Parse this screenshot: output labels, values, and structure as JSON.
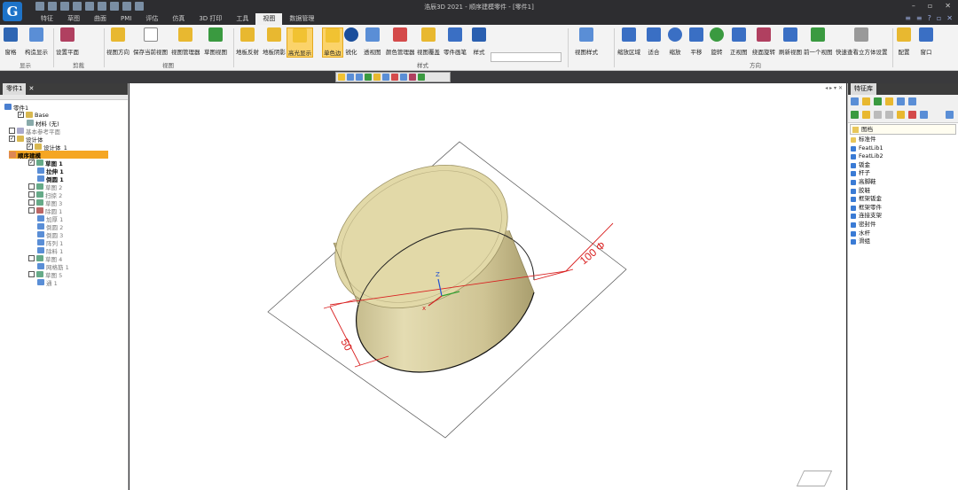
{
  "app": {
    "title": "浩辰3D 2021 - 顺序建模零件 - [零件1]"
  },
  "tabs": [
    "特征",
    "草图",
    "曲面",
    "PMI",
    "评估",
    "仿真",
    "3D 打印",
    "工具",
    "视图",
    "数据管理"
  ],
  "active_tab": "视图",
  "ribbon": {
    "buttons": [
      "窗格",
      "构造显示",
      "设置平面",
      "视图方向",
      "保存当前视图",
      "视图管理器",
      "草图视图",
      "地板反射",
      "地板阴影",
      "高光显示",
      "单色边",
      "锐化",
      "透视图",
      "颜色管理器",
      "视图覆盖",
      "零件画笔",
      "样式",
      "视图样式",
      "缩放区域",
      "适合",
      "缩放",
      "平移",
      "旋转",
      "正视图",
      "绕面旋转",
      "刷新视图",
      "前一个视图",
      "快速查看立方体设置",
      "配置",
      "窗口"
    ],
    "selected_button": "高光显示",
    "groups": [
      "显示",
      "剪裁",
      "视图",
      "样式",
      "方向"
    ]
  },
  "left_panel": {
    "tab": "零件1",
    "tree": [
      {
        "label": "零件1",
        "indent": 0
      },
      {
        "label": "Base",
        "indent": 1
      },
      {
        "label": "材料 (无)",
        "indent": 2
      },
      {
        "label": "基本参考平面",
        "indent": 1
      },
      {
        "label": "设计体",
        "indent": 1
      },
      {
        "label": "设计体_1",
        "indent": 2
      },
      {
        "label": "顺序建模",
        "indent": 1
      },
      {
        "label": "草图 1",
        "indent": 2
      },
      {
        "label": "拉伸 1",
        "indent": 2
      },
      {
        "label": "倒圆 1",
        "indent": 2
      },
      {
        "label": "草图 2",
        "indent": 2
      },
      {
        "label": "扫掠 2",
        "indent": 2
      },
      {
        "label": "草图 3",
        "indent": 2
      },
      {
        "label": "除圆 1",
        "indent": 2
      },
      {
        "label": "加厚 1",
        "indent": 3
      },
      {
        "label": "倒圆 2",
        "indent": 3
      },
      {
        "label": "倒圆 3",
        "indent": 3
      },
      {
        "label": "阵列 1",
        "indent": 3
      },
      {
        "label": "除料 1",
        "indent": 3
      },
      {
        "label": "草图 4",
        "indent": 2
      },
      {
        "label": "网格筋 1",
        "indent": 3
      },
      {
        "label": "草图 5",
        "indent": 2
      },
      {
        "label": "通 1",
        "indent": 3
      }
    ]
  },
  "viewport": {
    "dim_length": "50",
    "dim_diameter": "100 Φ"
  },
  "right_panel": {
    "tab": "特征库",
    "combo": "图档",
    "items": [
      "标准件",
      "FeatLib1",
      "FeatLib2",
      "钣金",
      "杆子",
      "高脚鞋",
      "胶鞋",
      "框架钣金",
      "框架零件",
      "连接支架",
      "密封件",
      "水杆",
      "滑组"
    ]
  },
  "colors": {
    "ribbon_bg": "#f3f3f3",
    "highlight": "#f5a623",
    "cylinder": "#ddd4a6",
    "dim": "#d92020"
  }
}
